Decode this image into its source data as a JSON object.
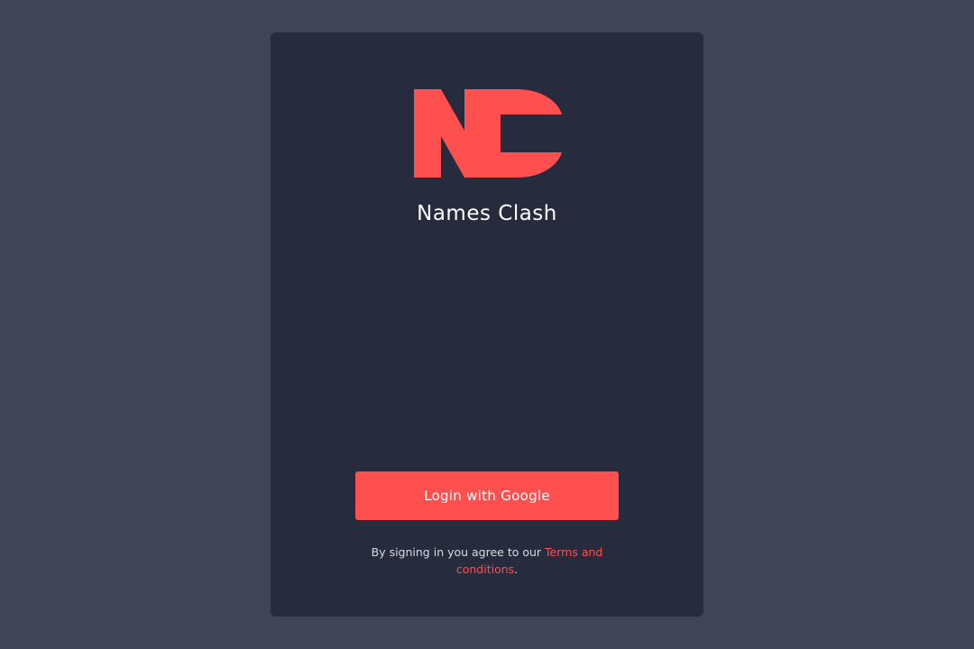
{
  "app": {
    "name": "Names Clash",
    "logo_icon": "names-clash-logo",
    "brand_color": "#ff4f4f"
  },
  "login": {
    "button_label": "Login with Google"
  },
  "legal": {
    "prefix": "By signing in you agree to our ",
    "link_label": "Terms and conditions",
    "suffix": "."
  },
  "colors": {
    "page_background": "#3f4456",
    "card_background": "#262b3d",
    "accent": "#ff4f4f",
    "text": "#ffffff"
  }
}
